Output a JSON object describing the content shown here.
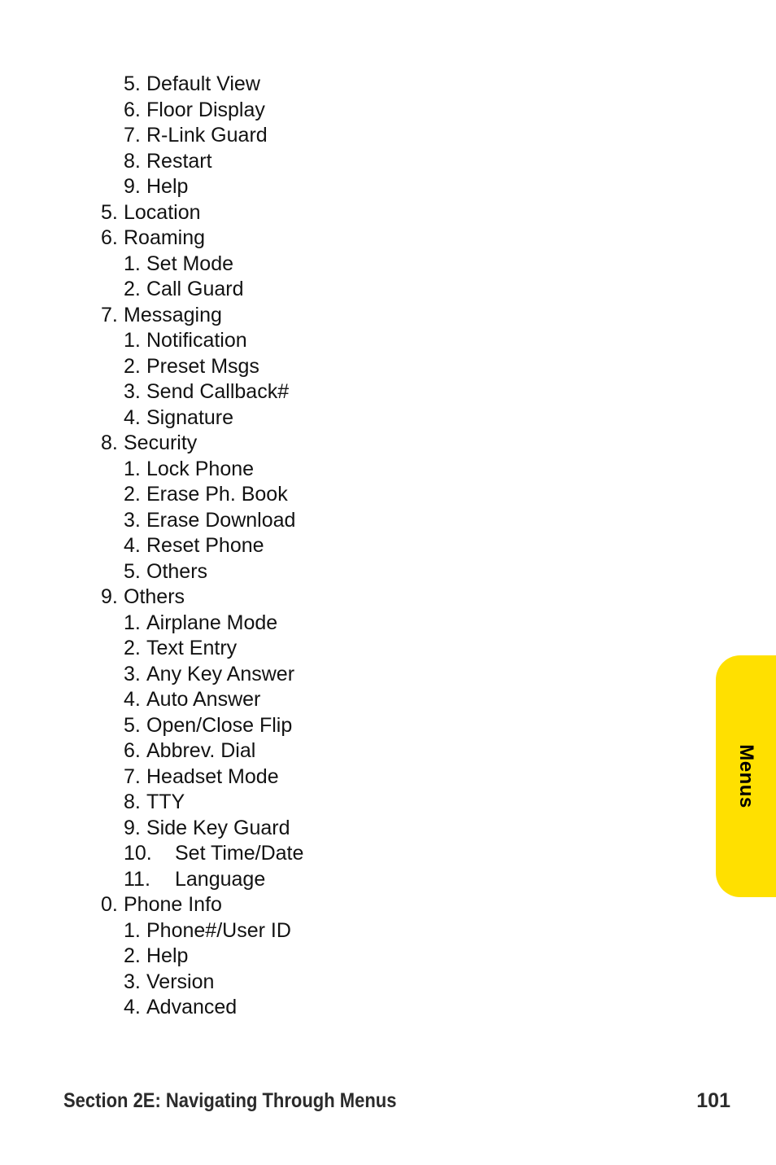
{
  "page": {
    "background_color": "#ffffff",
    "text_color": "#121212"
  },
  "side_tab": {
    "label": "Menus",
    "color": "#FFE000",
    "text_color": "#000000"
  },
  "outline": {
    "items": [
      {
        "level": 2,
        "marker": "5.",
        "label": "Default View"
      },
      {
        "level": 2,
        "marker": "6.",
        "label": "Floor Display"
      },
      {
        "level": 2,
        "marker": "7.",
        "label": "R-Link Guard"
      },
      {
        "level": 2,
        "marker": "8.",
        "label": "Restart"
      },
      {
        "level": 2,
        "marker": "9.",
        "label": "Help"
      },
      {
        "level": 1,
        "marker": "5.",
        "label": "Location"
      },
      {
        "level": 1,
        "marker": "6.",
        "label": "Roaming"
      },
      {
        "level": 2,
        "marker": "1.",
        "label": "Set Mode"
      },
      {
        "level": 2,
        "marker": "2.",
        "label": "Call Guard"
      },
      {
        "level": 1,
        "marker": "7.",
        "label": "Messaging"
      },
      {
        "level": 2,
        "marker": "1.",
        "label": "Notification"
      },
      {
        "level": 2,
        "marker": "2.",
        "label": "Preset Msgs"
      },
      {
        "level": 2,
        "marker": "3.",
        "label": "Send Callback#"
      },
      {
        "level": 2,
        "marker": "4.",
        "label": "Signature"
      },
      {
        "level": 1,
        "marker": "8.",
        "label": "Security"
      },
      {
        "level": 2,
        "marker": "1.",
        "label": "Lock Phone"
      },
      {
        "level": 2,
        "marker": "2.",
        "label": "Erase Ph. Book"
      },
      {
        "level": 2,
        "marker": "3.",
        "label": "Erase Download"
      },
      {
        "level": 2,
        "marker": "4.",
        "label": "Reset Phone"
      },
      {
        "level": 2,
        "marker": "5.",
        "label": "Others"
      },
      {
        "level": 1,
        "marker": "9.",
        "label": "Others"
      },
      {
        "level": 2,
        "marker": "1.",
        "label": "Airplane Mode"
      },
      {
        "level": 2,
        "marker": "2.",
        "label": "Text Entry"
      },
      {
        "level": 2,
        "marker": "3.",
        "label": "Any Key Answer"
      },
      {
        "level": 2,
        "marker": "4.",
        "label": "Auto Answer"
      },
      {
        "level": 2,
        "marker": "5.",
        "label": "Open/Close Flip"
      },
      {
        "level": 2,
        "marker": "6.",
        "label": "Abbrev. Dial"
      },
      {
        "level": 2,
        "marker": "7.",
        "label": "Headset Mode"
      },
      {
        "level": 2,
        "marker": "8.",
        "label": "TTY"
      },
      {
        "level": 2,
        "marker": "9.",
        "label": "Side Key Guard"
      },
      {
        "level": 2,
        "marker": "10.",
        "label": "Set Time/Date",
        "wide": true
      },
      {
        "level": 2,
        "marker": "11.",
        "label": "Language",
        "wide": true
      },
      {
        "level": 1,
        "marker": "0.",
        "label": "Phone Info"
      },
      {
        "level": 2,
        "marker": "1.",
        "label": "Phone#/User ID"
      },
      {
        "level": 2,
        "marker": "2.",
        "label": "Help"
      },
      {
        "level": 2,
        "marker": "3.",
        "label": "Version"
      },
      {
        "level": 2,
        "marker": "4.",
        "label": "Advanced"
      }
    ]
  },
  "footer": {
    "title": "Section 2E: Navigating Through Menus",
    "page_number": "101"
  }
}
